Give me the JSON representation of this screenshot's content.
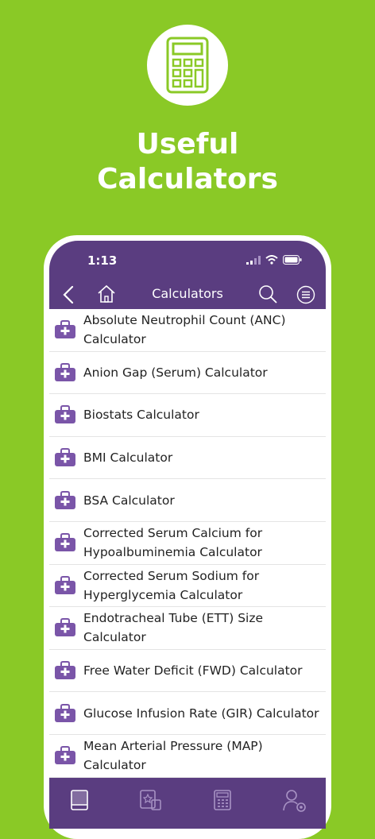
{
  "hero": {
    "icon": "calculator-icon",
    "line1": "Useful",
    "line2": "Calculators"
  },
  "status": {
    "time": "1:13"
  },
  "nav": {
    "title": "Calculators"
  },
  "items": [
    {
      "label": "Absolute Neutrophil Count (ANC) Calculator"
    },
    {
      "label": "Anion Gap (Serum) Calculator"
    },
    {
      "label": "Biostats Calculator"
    },
    {
      "label": "BMI Calculator"
    },
    {
      "label": "BSA Calculator"
    },
    {
      "label": "Corrected Serum Calcium for Hypoalbuminemia Calculator"
    },
    {
      "label": "Corrected Serum Sodium for Hyperglycemia Calculator"
    },
    {
      "label": "Endotracheal Tube (ETT) Size Calculator"
    },
    {
      "label": "Free Water Deficit (FWD) Calculator"
    },
    {
      "label": "Glucose Infusion Rate (GIR) Calculator"
    },
    {
      "label": "Mean Arterial Pressure (MAP) Calculator"
    }
  ],
  "colors": {
    "background": "#8ac926",
    "accent": "#5a3d80",
    "list_icon": "#7a55a8"
  }
}
